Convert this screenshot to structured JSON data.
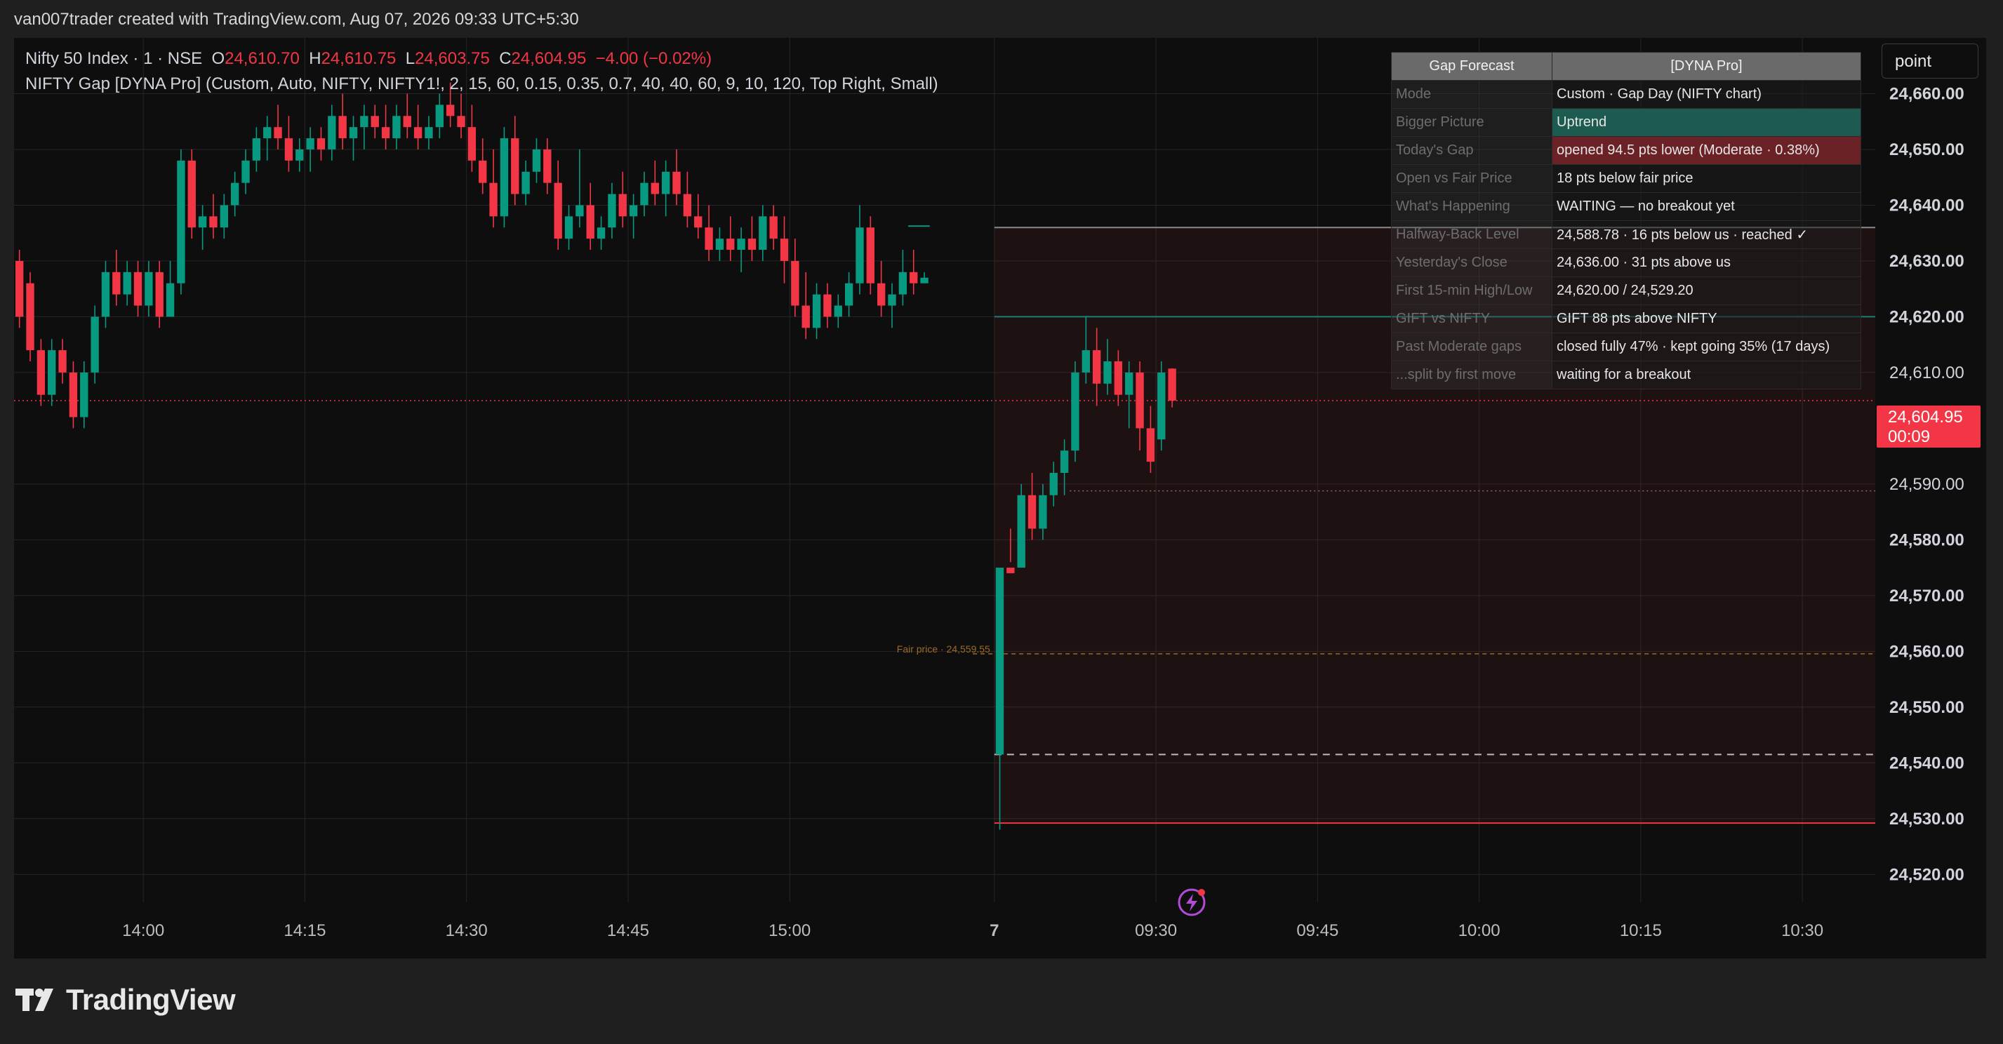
{
  "page": {
    "caption": "van007trader created with TradingView.com, Aug 07, 2026 09:33 UTC+5:30",
    "brand": "TradingView"
  },
  "legend": {
    "symbol": "Nifty 50 Index · 1 · NSE",
    "o_label": "O",
    "o_value": "24,610.70",
    "h_label": "H",
    "h_value": "24,610.75",
    "l_label": "L",
    "l_value": "24,603.75",
    "c_label": "C",
    "c_value": "24,604.95",
    "change": "−4.00 (−0.02%)",
    "indicator": "NIFTY Gap [DYNA Pro] (Custom, Auto, NIFTY, NIFTY1!, 2, 15, 60, 0.15, 0.35, 0.7, 40, 40, 60, 9, 10, 120, Top Right, Small)"
  },
  "toolbar": {
    "point_label": "point"
  },
  "price_badge": {
    "price": "24,604.95",
    "countdown": "00:09"
  },
  "gap_table": {
    "header": [
      "Gap Forecast",
      "[DYNA Pro]"
    ],
    "rows": [
      {
        "key": "Mode",
        "value": "Custom · Gap Day (NIFTY chart)",
        "tone": ""
      },
      {
        "key": "Bigger Picture",
        "value": "Uptrend",
        "tone": "up"
      },
      {
        "key": "Today's Gap",
        "value": "opened 94.5 pts lower (Moderate · 0.38%)",
        "tone": "down"
      },
      {
        "key": "Open vs Fair Price",
        "value": "18 pts below fair price",
        "tone": ""
      },
      {
        "key": "What's Happening",
        "value": "WAITING — no breakout yet",
        "tone": ""
      },
      {
        "key": "Halfway-Back Level",
        "value": "24,588.78 · 16 pts below us · reached ✓",
        "tone": ""
      },
      {
        "key": "Yesterday's Close",
        "value": "24,636.00 · 31 pts above us",
        "tone": ""
      },
      {
        "key": "First 15-min High/Low",
        "value": "24,620.00 / 24,529.20",
        "tone": ""
      },
      {
        "key": "GIFT vs NIFTY",
        "value": "GIFT 88 pts above NIFTY",
        "tone": ""
      },
      {
        "key": "Past Moderate gaps",
        "value": "closed fully 47% · kept going 35% (17 days)",
        "tone": ""
      },
      {
        "key": "...split by first move",
        "value": "waiting for a breakout",
        "tone": ""
      }
    ]
  },
  "colors": {
    "up": "#089981",
    "down": "#f23645",
    "background": "#0e0e0e",
    "grid": "#262626",
    "axis_text": "#bdbdbd",
    "fair_price": "#9a6a2a",
    "prev_close": "#8a8a8a",
    "high15": "#1a7f75",
    "low15": "#f23645"
  },
  "chart_data": {
    "type": "candlestick",
    "title": "Nifty 50 Index · 1 · NSE",
    "ylim": [
      24515,
      24670
    ],
    "y_ticks": [
      "24,660.00",
      "24,650.00",
      "24,640.00",
      "24,630.00",
      "24,620.00",
      "24,610.00",
      "24,590.00",
      "24,580.00",
      "24,570.00",
      "24,560.00",
      "24,550.00",
      "24,540.00",
      "24,530.00",
      "24,520.00"
    ],
    "y_tick_values": [
      24660,
      24650,
      24640,
      24630,
      24620,
      24610,
      24590,
      24580,
      24570,
      24560,
      24550,
      24540,
      24530,
      24520
    ],
    "x_ticks": [
      "14:00",
      "14:15",
      "14:30",
      "14:45",
      "15:00",
      "7",
      "09:30",
      "09:45",
      "10:00",
      "10:15",
      "10:30"
    ],
    "x_tick_bars": [
      12,
      27,
      42,
      57,
      72,
      91,
      106,
      121,
      136,
      151,
      166
    ],
    "session_break_bar": 91,
    "levels": [
      {
        "name": "Yesterday's Close",
        "value": 24636.0,
        "style": "solid"
      },
      {
        "name": "First 15-min High",
        "value": 24620.0,
        "style": "solid"
      },
      {
        "name": "Last price",
        "value": 24604.95,
        "style": "dotted"
      },
      {
        "name": "Halfway-Back Level",
        "value": 24588.78,
        "style": "dotted"
      },
      {
        "name": "Fair price",
        "value": 24559.55,
        "style": "dashed"
      },
      {
        "name": "Gap open",
        "value": 24541.5,
        "style": "dashed"
      },
      {
        "name": "First 15-min Low",
        "value": 24529.2,
        "style": "solid"
      }
    ],
    "fair_price_label": "Fair price · 24,559.55",
    "candles": [
      [
        0,
        24630,
        24632,
        24618,
        24620
      ],
      [
        1,
        24626,
        24628,
        24612,
        24614
      ],
      [
        2,
        24614,
        24616,
        24604,
        24606
      ],
      [
        3,
        24606,
        24616,
        24604,
        24614
      ],
      [
        4,
        24614,
        24616,
        24608,
        24610
      ],
      [
        5,
        24610,
        24612,
        24600,
        24602
      ],
      [
        6,
        24602,
        24612,
        24600,
        24610
      ],
      [
        7,
        24610,
        24622,
        24608,
        24620
      ],
      [
        8,
        24620,
        24630,
        24618,
        24628
      ],
      [
        9,
        24628,
        24632,
        24622,
        24624
      ],
      [
        10,
        24624,
        24630,
        24622,
        24628
      ],
      [
        11,
        24628,
        24630,
        24620,
        24622
      ],
      [
        12,
        24622,
        24630,
        24620,
        24628
      ],
      [
        13,
        24628,
        24630,
        24618,
        24620
      ],
      [
        14,
        24620,
        24630,
        24620,
        24626
      ],
      [
        15,
        24626,
        24650,
        24624,
        24648
      ],
      [
        16,
        24648,
        24650,
        24634,
        24636
      ],
      [
        17,
        24636,
        24640,
        24632,
        24638
      ],
      [
        18,
        24638,
        24642,
        24634,
        24636
      ],
      [
        19,
        24636,
        24642,
        24634,
        24640
      ],
      [
        20,
        24640,
        24646,
        24638,
        24644
      ],
      [
        21,
        24644,
        24650,
        24642,
        24648
      ],
      [
        22,
        24648,
        24654,
        24646,
        24652
      ],
      [
        23,
        24652,
        24656,
        24648,
        24654
      ],
      [
        24,
        24654,
        24658,
        24650,
        24652
      ],
      [
        25,
        24652,
        24656,
        24646,
        24648
      ],
      [
        26,
        24648,
        24652,
        24646,
        24650
      ],
      [
        27,
        24650,
        24654,
        24646,
        24652
      ],
      [
        28,
        24652,
        24654,
        24648,
        24650
      ],
      [
        29,
        24650,
        24658,
        24648,
        24656
      ],
      [
        30,
        24656,
        24660,
        24650,
        24652
      ],
      [
        31,
        24652,
        24656,
        24648,
        24654
      ],
      [
        32,
        24654,
        24658,
        24650,
        24656
      ],
      [
        33,
        24656,
        24658,
        24652,
        24654
      ],
      [
        34,
        24654,
        24658,
        24650,
        24652
      ],
      [
        35,
        24652,
        24658,
        24650,
        24656
      ],
      [
        36,
        24656,
        24660,
        24652,
        24654
      ],
      [
        37,
        24654,
        24658,
        24650,
        24652
      ],
      [
        38,
        24652,
        24656,
        24650,
        24654
      ],
      [
        39,
        24654,
        24660,
        24652,
        24658
      ],
      [
        40,
        24658,
        24662,
        24654,
        24656
      ],
      [
        41,
        24656,
        24660,
        24652,
        24654
      ],
      [
        42,
        24654,
        24658,
        24646,
        24648
      ],
      [
        43,
        24648,
        24652,
        24642,
        24644
      ],
      [
        44,
        24644,
        24650,
        24636,
        24638
      ],
      [
        45,
        24638,
        24654,
        24636,
        24652
      ],
      [
        46,
        24652,
        24656,
        24640,
        24642
      ],
      [
        47,
        24642,
        24648,
        24640,
        24646
      ],
      [
        48,
        24646,
        24652,
        24644,
        24650
      ],
      [
        49,
        24650,
        24652,
        24642,
        24644
      ],
      [
        50,
        24644,
        24648,
        24632,
        24634
      ],
      [
        51,
        24634,
        24640,
        24632,
        24638
      ],
      [
        52,
        24638,
        24650,
        24636,
        24640
      ],
      [
        53,
        24640,
        24644,
        24632,
        24634
      ],
      [
        54,
        24634,
        24638,
        24632,
        24636
      ],
      [
        55,
        24636,
        24644,
        24634,
        24642
      ],
      [
        56,
        24642,
        24646,
        24636,
        24638
      ],
      [
        57,
        24638,
        24642,
        24634,
        24640
      ],
      [
        58,
        24640,
        24646,
        24638,
        24644
      ],
      [
        59,
        24644,
        24648,
        24640,
        24642
      ],
      [
        60,
        24642,
        24648,
        24638,
        24646
      ],
      [
        61,
        24646,
        24650,
        24640,
        24642
      ],
      [
        62,
        24642,
        24646,
        24636,
        24638
      ],
      [
        63,
        24638,
        24642,
        24634,
        24636
      ],
      [
        64,
        24636,
        24640,
        24630,
        24632
      ],
      [
        65,
        24632,
        24636,
        24630,
        24634
      ],
      [
        66,
        24634,
        24638,
        24630,
        24632
      ],
      [
        67,
        24632,
        24636,
        24628,
        24634
      ],
      [
        68,
        24634,
        24638,
        24630,
        24632
      ],
      [
        69,
        24632,
        24640,
        24630,
        24638
      ],
      [
        70,
        24638,
        24640,
        24632,
        24634
      ],
      [
        71,
        24634,
        24638,
        24626,
        24630
      ],
      [
        72,
        24630,
        24634,
        24620,
        24622
      ],
      [
        73,
        24622,
        24628,
        24616,
        24618
      ],
      [
        74,
        24618,
        24626,
        24616,
        24624
      ],
      [
        75,
        24624,
        24626,
        24618,
        24620
      ],
      [
        76,
        24620,
        24624,
        24618,
        24622
      ],
      [
        77,
        24622,
        24628,
        24620,
        24626
      ],
      [
        78,
        24626,
        24640,
        24624,
        24636
      ],
      [
        79,
        24636,
        24638,
        24624,
        24626
      ],
      [
        80,
        24626,
        24630,
        24620,
        24622
      ],
      [
        81,
        24622,
        24626,
        24618,
        24624
      ],
      [
        82,
        24624,
        24632,
        24622,
        24628
      ],
      [
        83,
        24628,
        24632,
        24624,
        24626
      ],
      [
        84,
        24626,
        24628,
        24626,
        24627
      ],
      [
        91,
        24541.5,
        24568,
        24528,
        24575
      ],
      [
        92,
        24575,
        24582,
        24576,
        24574
      ],
      [
        93,
        24575,
        24590,
        24578,
        24588
      ],
      [
        94,
        24588,
        24592,
        24580,
        24582
      ],
      [
        95,
        24582,
        24590,
        24580,
        24588
      ],
      [
        96,
        24588,
        24594,
        24586,
        24592
      ],
      [
        97,
        24592,
        24598,
        24588,
        24596
      ],
      [
        98,
        24596,
        24612,
        24594,
        24610
      ],
      [
        99,
        24610,
        24620,
        24608,
        24614
      ],
      [
        100,
        24614,
        24618,
        24604,
        24608
      ],
      [
        101,
        24608,
        24616,
        24606,
        24612
      ],
      [
        102,
        24612,
        24614,
        24604,
        24606
      ],
      [
        103,
        24606,
        24612,
        24600,
        24610
      ],
      [
        104,
        24610,
        24612,
        24596,
        24600
      ],
      [
        105,
        24600,
        24604,
        24592,
        24594
      ],
      [
        106,
        24598,
        24612,
        24596,
        24610
      ],
      [
        107,
        24610.7,
        24610.75,
        24603.75,
        24604.95
      ]
    ]
  }
}
